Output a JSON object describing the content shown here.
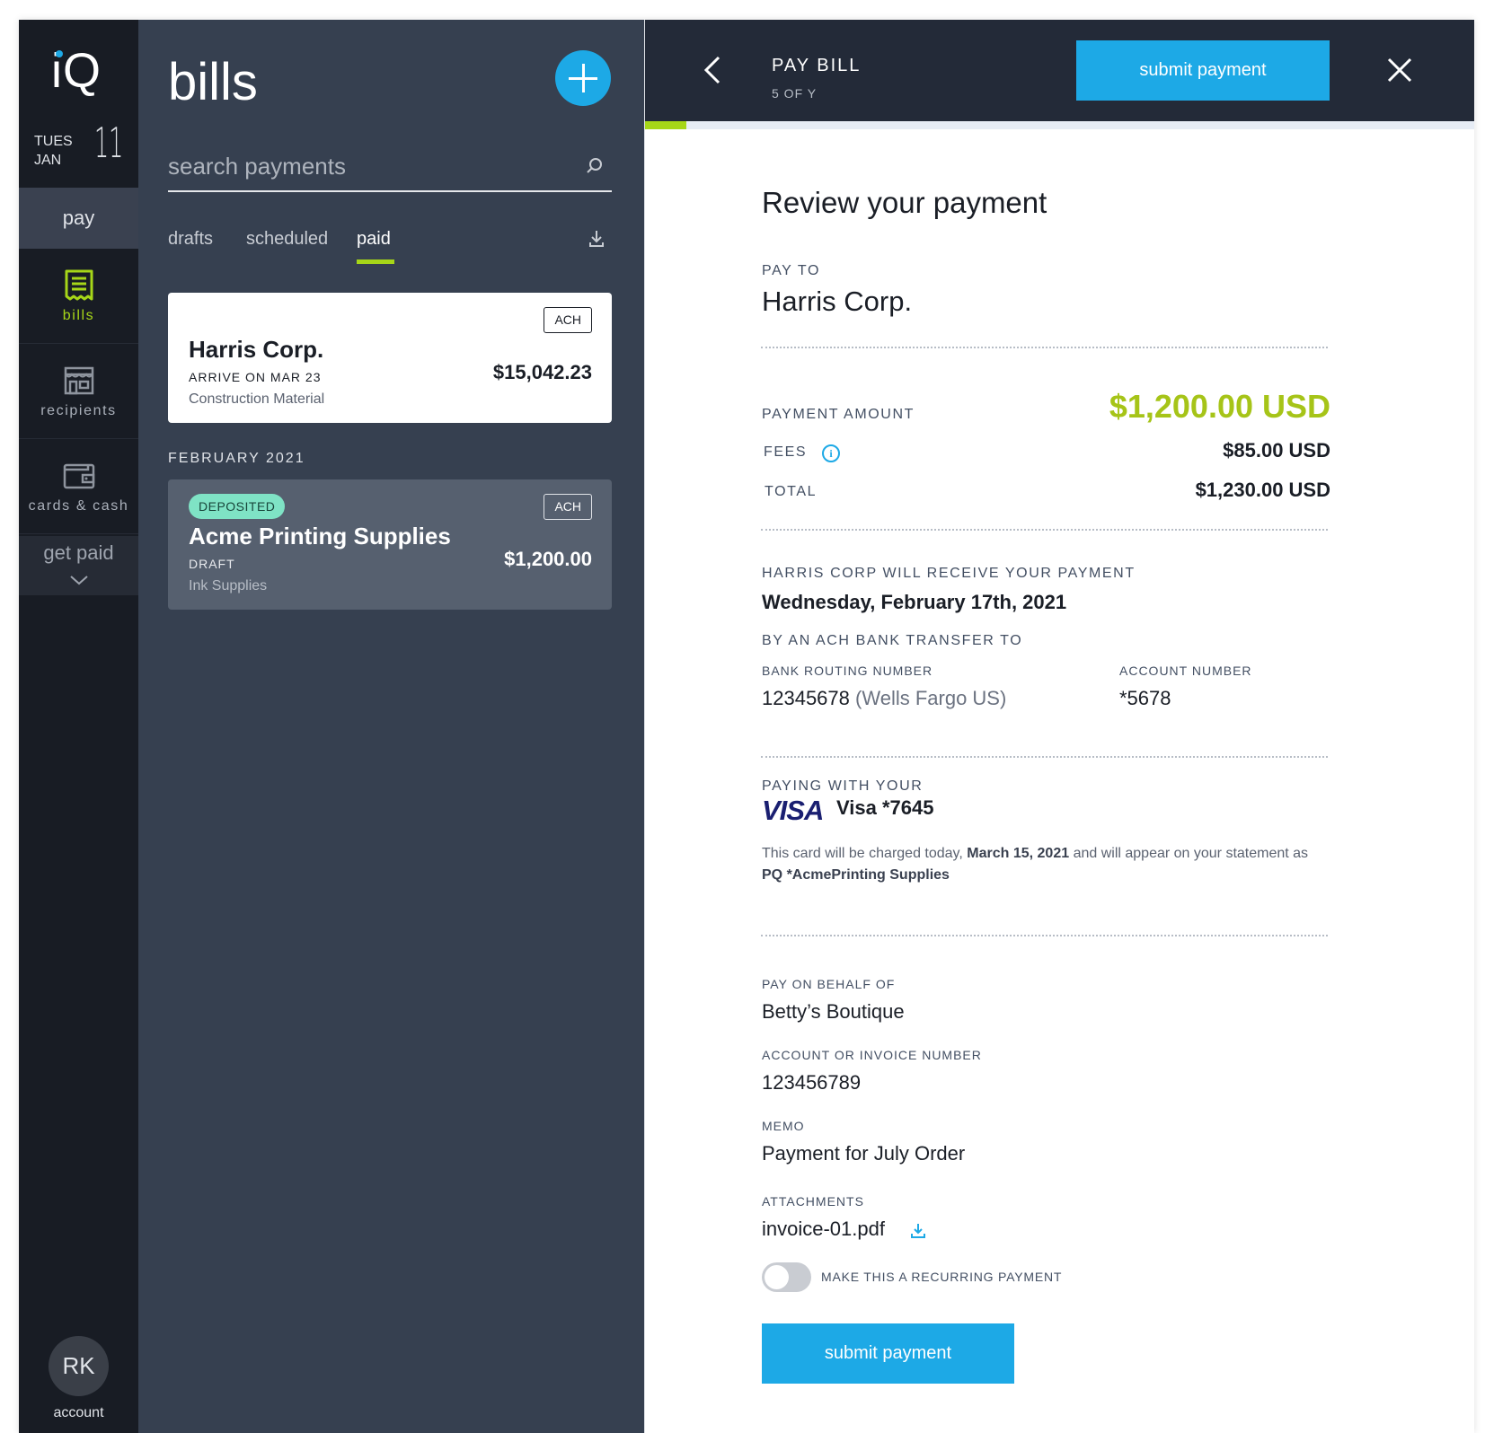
{
  "rail": {
    "logo": "iQ",
    "date": {
      "weekday": "TUES",
      "month": "JAN",
      "day": "11"
    },
    "pay_label": "pay",
    "items": [
      {
        "label": "bills",
        "icon": "receipt-icon",
        "active": true
      },
      {
        "label": "recipients",
        "icon": "storefront-icon",
        "active": false
      },
      {
        "label": "cards & cash",
        "icon": "wallet-icon",
        "active": false
      }
    ],
    "get_paid_label": "get paid",
    "avatar_initials": "RK",
    "account_label": "account"
  },
  "list": {
    "title": "bills",
    "search_placeholder": "search payments",
    "tabs": [
      {
        "label": "drafts",
        "active": false
      },
      {
        "label": "scheduled",
        "active": false
      },
      {
        "label": "paid",
        "active": true
      }
    ],
    "cards": [
      {
        "name": "Harris Corp.",
        "tag": "ACH",
        "sub": "ARRIVE ON MAR 23",
        "desc": "Construction Material",
        "amount": "$15,042.23"
      }
    ],
    "section_label": "FEBRUARY 2021",
    "section_cards": [
      {
        "badge": "DEPOSITED",
        "name": "Acme Printing Supplies",
        "tag": "ACH",
        "sub": "DRAFT",
        "desc": "Ink Supplies",
        "amount": "$1,200.00"
      }
    ]
  },
  "detail": {
    "header": {
      "title": "PAY BILL",
      "step": "5 OF Y",
      "submit_label": "submit payment",
      "progress": 0.05
    },
    "heading": "Review your payment",
    "pay_to_label": "PAY TO",
    "pay_to": "Harris Corp.",
    "amount_label": "PAYMENT AMOUNT",
    "amount": "$1,200.00 USD",
    "fees_label": "FEES",
    "fees": "$85.00 USD",
    "total_label": "TOTAL",
    "total": "$1,230.00 USD",
    "receive_label": "HARRIS CORP WILL RECEIVE YOUR PAYMENT",
    "receive_date": "Wednesday, February 17th, 2021",
    "transfer_label": "BY AN ACH BANK TRANSFER TO",
    "routing_label": "BANK ROUTING NUMBER",
    "routing_number": "12345678",
    "routing_bank": "(Wells Fargo US)",
    "account_label": "ACCOUNT NUMBER",
    "account_number": "*5678",
    "paying_with_label": "PAYING WITH YOUR",
    "card_brand": "VISA",
    "card_text": "Visa *7645",
    "charge_note": {
      "part1": "This card will be charged today, ",
      "date": "March 15, 2021",
      "part2": " and will appear on your statement as ",
      "descriptor": "PQ *AcmePrinting Supplies"
    },
    "behalf_label": "PAY ON BEHALF OF",
    "behalf": "Betty’s Boutique",
    "invoice_label": "ACCOUNT OR INVOICE NUMBER",
    "invoice": "123456789",
    "memo_label": "MEMO",
    "memo": "Payment for July Order",
    "attachments_label": "ATTACHMENTS",
    "attachment": "invoice-01.pdf",
    "recurring_label": "MAKE THIS A RECURRING PAYMENT",
    "recurring_on": false,
    "submit_label": "submit payment"
  },
  "colors": {
    "accent_blue": "#1da9e6",
    "accent_green": "#a6d618",
    "amount_green": "#a6c418",
    "rail_bg": "#181c24",
    "list_bg": "#364050",
    "topbar_bg": "#232a38"
  }
}
